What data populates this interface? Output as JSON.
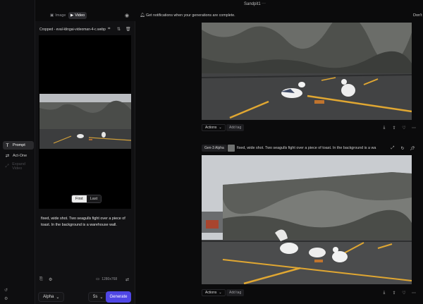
{
  "topbar": {
    "title": "Sandpit1",
    "title_menu": "···",
    "mode_tabs": [
      {
        "label": "Image",
        "active": false
      },
      {
        "label": "Video",
        "active": true
      }
    ],
    "notification_text": "Get notifications when your generations are complete.",
    "dismiss_label": "Don't"
  },
  "rail": {
    "items": [
      {
        "label": "Prompt",
        "icon": "text-t-icon",
        "active": true,
        "enabled": true
      },
      {
        "label": "Act-One",
        "icon": "act-one-icon",
        "active": false,
        "enabled": true
      },
      {
        "label": "Expand Video",
        "icon": "expand-icon",
        "active": false,
        "enabled": false
      }
    ]
  },
  "editor": {
    "filename": "Cropped - eval-klingai-videoman-4-c.webp",
    "frame_tabs": [
      {
        "label": "First",
        "active": true
      },
      {
        "label": "Last",
        "active": false
      }
    ],
    "prompt_text": "fixed, wide shot. Two seagulls fight over a piece of toast. In the background is a warehouse wall.",
    "resolution": "1280x768",
    "model": "Alpha",
    "duration": "5s",
    "generate_label": "Generate"
  },
  "feed": {
    "cards": [
      {
        "actions_label": "Actions",
        "add_tag_label": "Add tag"
      },
      {
        "model_badge": "Gen-3 Alpha",
        "prompt": "fixed, wide shot. Two seagulls fight over a piece of toast. In the background is a wa",
        "actions_label": "Actions",
        "add_tag_label": "Add tag"
      }
    ]
  },
  "colors": {
    "accent": "#4f46e5",
    "background": "#0b0b0c",
    "panel": "#111113"
  }
}
